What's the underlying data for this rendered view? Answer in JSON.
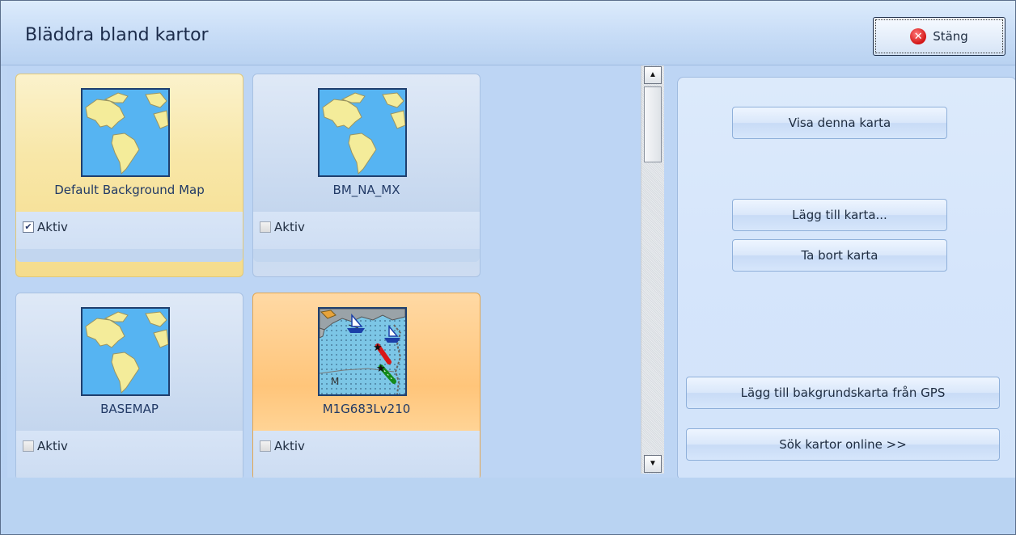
{
  "header": {
    "title": "Bläddra bland kartor",
    "close_label": "Stäng",
    "close_icon": "red-x-icon"
  },
  "maps": [
    {
      "name": "Default Background Map",
      "active_label": "Aktiv",
      "active": true,
      "selected": true,
      "thumbnail": "world-map-icon"
    },
    {
      "name": "BM_NA_MX",
      "active_label": "Aktiv",
      "active": false,
      "selected": false,
      "thumbnail": "world-map-icon"
    },
    {
      "name": "BASEMAP",
      "active_label": "Aktiv",
      "active": false,
      "selected": false,
      "thumbnail": "world-map-icon"
    },
    {
      "name": "M1G683Lv210",
      "active_label": "Aktiv",
      "active": false,
      "selected": true,
      "thumbnail": "nautical-chart-icon"
    }
  ],
  "actions": {
    "show_map": "Visa denna karta",
    "add_map": "Lägg till karta...",
    "remove_map": "Ta bort karta",
    "add_gps_background": "Lägg till bakgrundskarta från GPS",
    "search_online": "Sök kartor online >>"
  },
  "colors": {
    "selected_default": "#f8e7a8",
    "selected_orange": "#ffc57a",
    "window_bg": "#bdd5f4"
  }
}
